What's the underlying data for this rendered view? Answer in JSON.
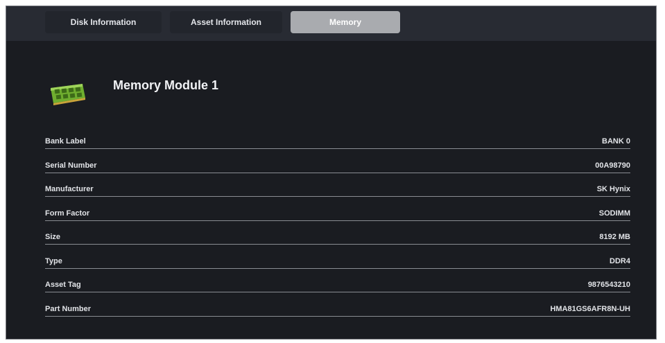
{
  "tabs": [
    {
      "label": "Disk Information",
      "selected": false
    },
    {
      "label": "Asset Information",
      "selected": false
    },
    {
      "label": "Memory",
      "selected": true
    }
  ],
  "module": {
    "title": "Memory Module 1",
    "icon": "ram-module-icon"
  },
  "properties": [
    {
      "label": "Bank Label",
      "value": "BANK 0"
    },
    {
      "label": "Serial Number",
      "value": "00A98790"
    },
    {
      "label": "Manufacturer",
      "value": "SK Hynix"
    },
    {
      "label": "Form Factor",
      "value": "SODIMM"
    },
    {
      "label": "Size",
      "value": "8192 MB"
    },
    {
      "label": "Type",
      "value": "DDR4"
    },
    {
      "label": "Asset Tag",
      "value": "9876543210"
    },
    {
      "label": "Part Number",
      "value": "HMA81GS6AFR8N-UH"
    }
  ],
  "colors": {
    "background": "#1a1c21",
    "tabbar": "#282b33",
    "selected_tab": "#a9abaf",
    "ram_green": "#7fbf3a"
  }
}
